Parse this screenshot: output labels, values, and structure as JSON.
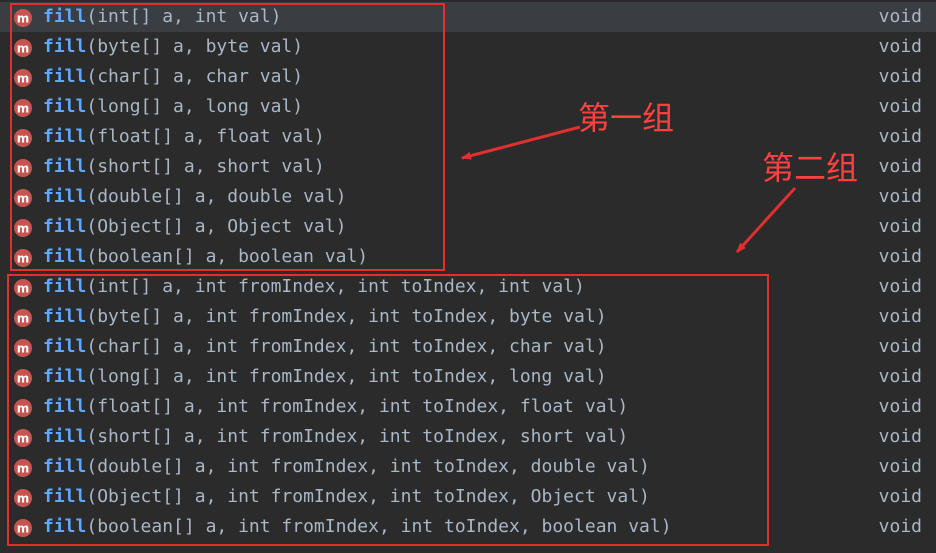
{
  "colors": {
    "background": "#2b2b2b",
    "selected_row": "#3a3d41",
    "method_name": "#60a8ff",
    "text": "#a9b7c6",
    "icon_fill": "#c75450",
    "annotation": "#e03030"
  },
  "icons": {
    "method": "method-m-icon"
  },
  "items": [
    {
      "name": "fill",
      "params": "(int[] a, int val)",
      "return_type": "void"
    },
    {
      "name": "fill",
      "params": "(byte[] a, byte val)",
      "return_type": "void"
    },
    {
      "name": "fill",
      "params": "(char[] a, char val)",
      "return_type": "void"
    },
    {
      "name": "fill",
      "params": "(long[] a, long val)",
      "return_type": "void"
    },
    {
      "name": "fill",
      "params": "(float[] a, float val)",
      "return_type": "void"
    },
    {
      "name": "fill",
      "params": "(short[] a, short val)",
      "return_type": "void"
    },
    {
      "name": "fill",
      "params": "(double[] a, double val)",
      "return_type": "void"
    },
    {
      "name": "fill",
      "params": "(Object[] a, Object val)",
      "return_type": "void"
    },
    {
      "name": "fill",
      "params": "(boolean[] a, boolean val)",
      "return_type": "void"
    },
    {
      "name": "fill",
      "params": "(int[] a, int fromIndex, int toIndex, int val)",
      "return_type": "void"
    },
    {
      "name": "fill",
      "params": "(byte[] a, int fromIndex, int toIndex, byte val)",
      "return_type": "void"
    },
    {
      "name": "fill",
      "params": "(char[] a, int fromIndex, int toIndex, char val)",
      "return_type": "void"
    },
    {
      "name": "fill",
      "params": "(long[] a, int fromIndex, int toIndex, long val)",
      "return_type": "void"
    },
    {
      "name": "fill",
      "params": "(float[] a, int fromIndex, int toIndex, float val)",
      "return_type": "void"
    },
    {
      "name": "fill",
      "params": "(short[] a, int fromIndex, int toIndex, short val)",
      "return_type": "void"
    },
    {
      "name": "fill",
      "params": "(double[] a, int fromIndex, int toIndex, double val)",
      "return_type": "void"
    },
    {
      "name": "fill",
      "params": "(Object[] a, int fromIndex, int toIndex, Object val)",
      "return_type": "void"
    },
    {
      "name": "fill",
      "params": "(boolean[] a, int fromIndex, int toIndex, boolean val)",
      "return_type": "void"
    }
  ],
  "annotations": {
    "group1_label": "第一组",
    "group2_label": "第二组"
  }
}
